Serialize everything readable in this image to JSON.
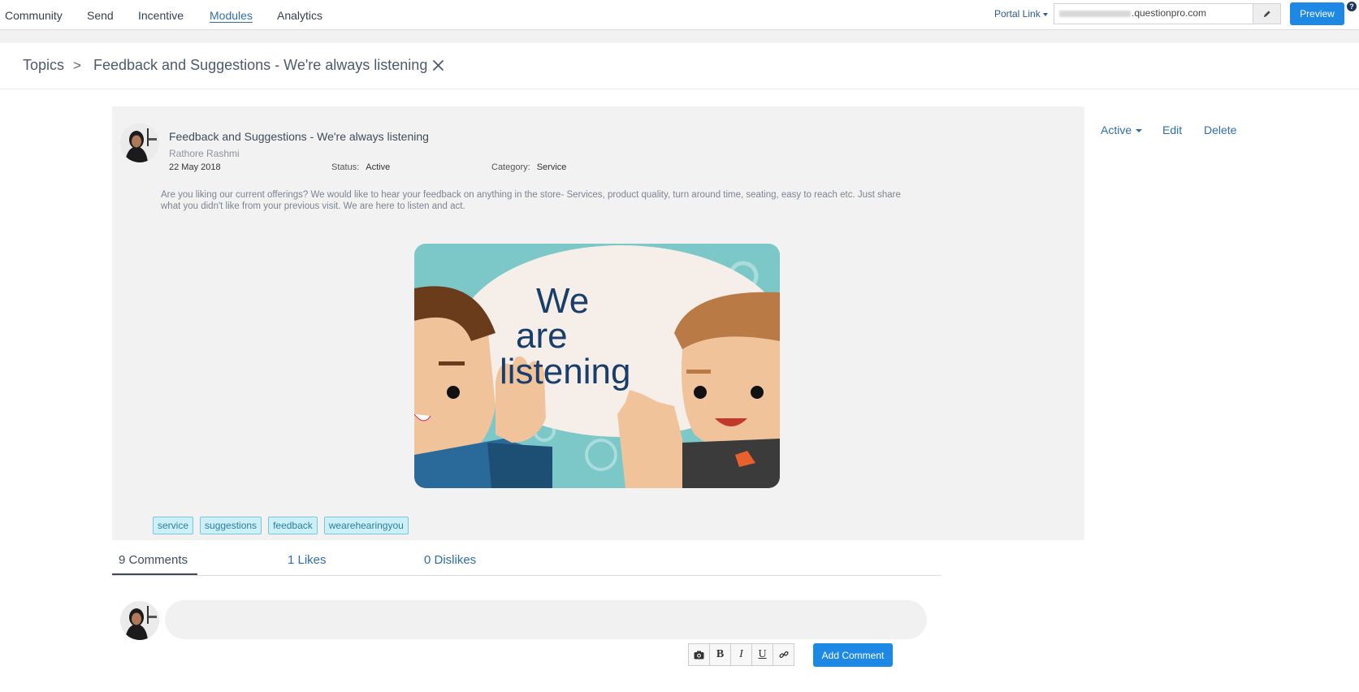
{
  "nav": {
    "items": [
      {
        "label": "Community"
      },
      {
        "label": "Send"
      },
      {
        "label": "Incentive"
      },
      {
        "label": "Modules"
      },
      {
        "label": "Analytics"
      }
    ],
    "portal_link_label": "Portal Link",
    "portal_domain": ".questionpro.com",
    "preview_label": "Preview"
  },
  "breadcrumb": {
    "root": "Topics",
    "separator": ">",
    "current": "Feedback and Suggestions - We're always listening"
  },
  "post": {
    "title": "Feedback and Suggestions - We're always listening",
    "author": "Rathore Rashmi",
    "date": "22 May 2018",
    "status_label": "Status:",
    "status_value": "Active",
    "category_label": "Category:",
    "category_value": "Service",
    "description": "Are you liking our current offerings? We would like to hear your feedback on anything in the store- Services, product quality, turn around time, seating, easy to reach etc. Just share what you didn't like from your previous visit. We are here to listen and act.",
    "image_text": [
      "We",
      "are",
      "listening"
    ],
    "tags": [
      "service",
      "suggestions",
      "feedback",
      "wearehearingyou"
    ]
  },
  "actions": {
    "status": "Active",
    "edit": "Edit",
    "delete": "Delete"
  },
  "tabs": {
    "comments": "9 Comments",
    "likes": "1 Likes",
    "dislikes": "0 Dislikes"
  },
  "composer": {
    "placeholder": "",
    "tools": [
      "camera-icon",
      "B",
      "I",
      "U",
      "link-icon"
    ],
    "submit_label": "Add Comment"
  },
  "colors": {
    "accent": "#1e88e5",
    "link": "#2f6da8",
    "tag_bg": "#cdeff7",
    "tag_border": "#7ac7da"
  }
}
